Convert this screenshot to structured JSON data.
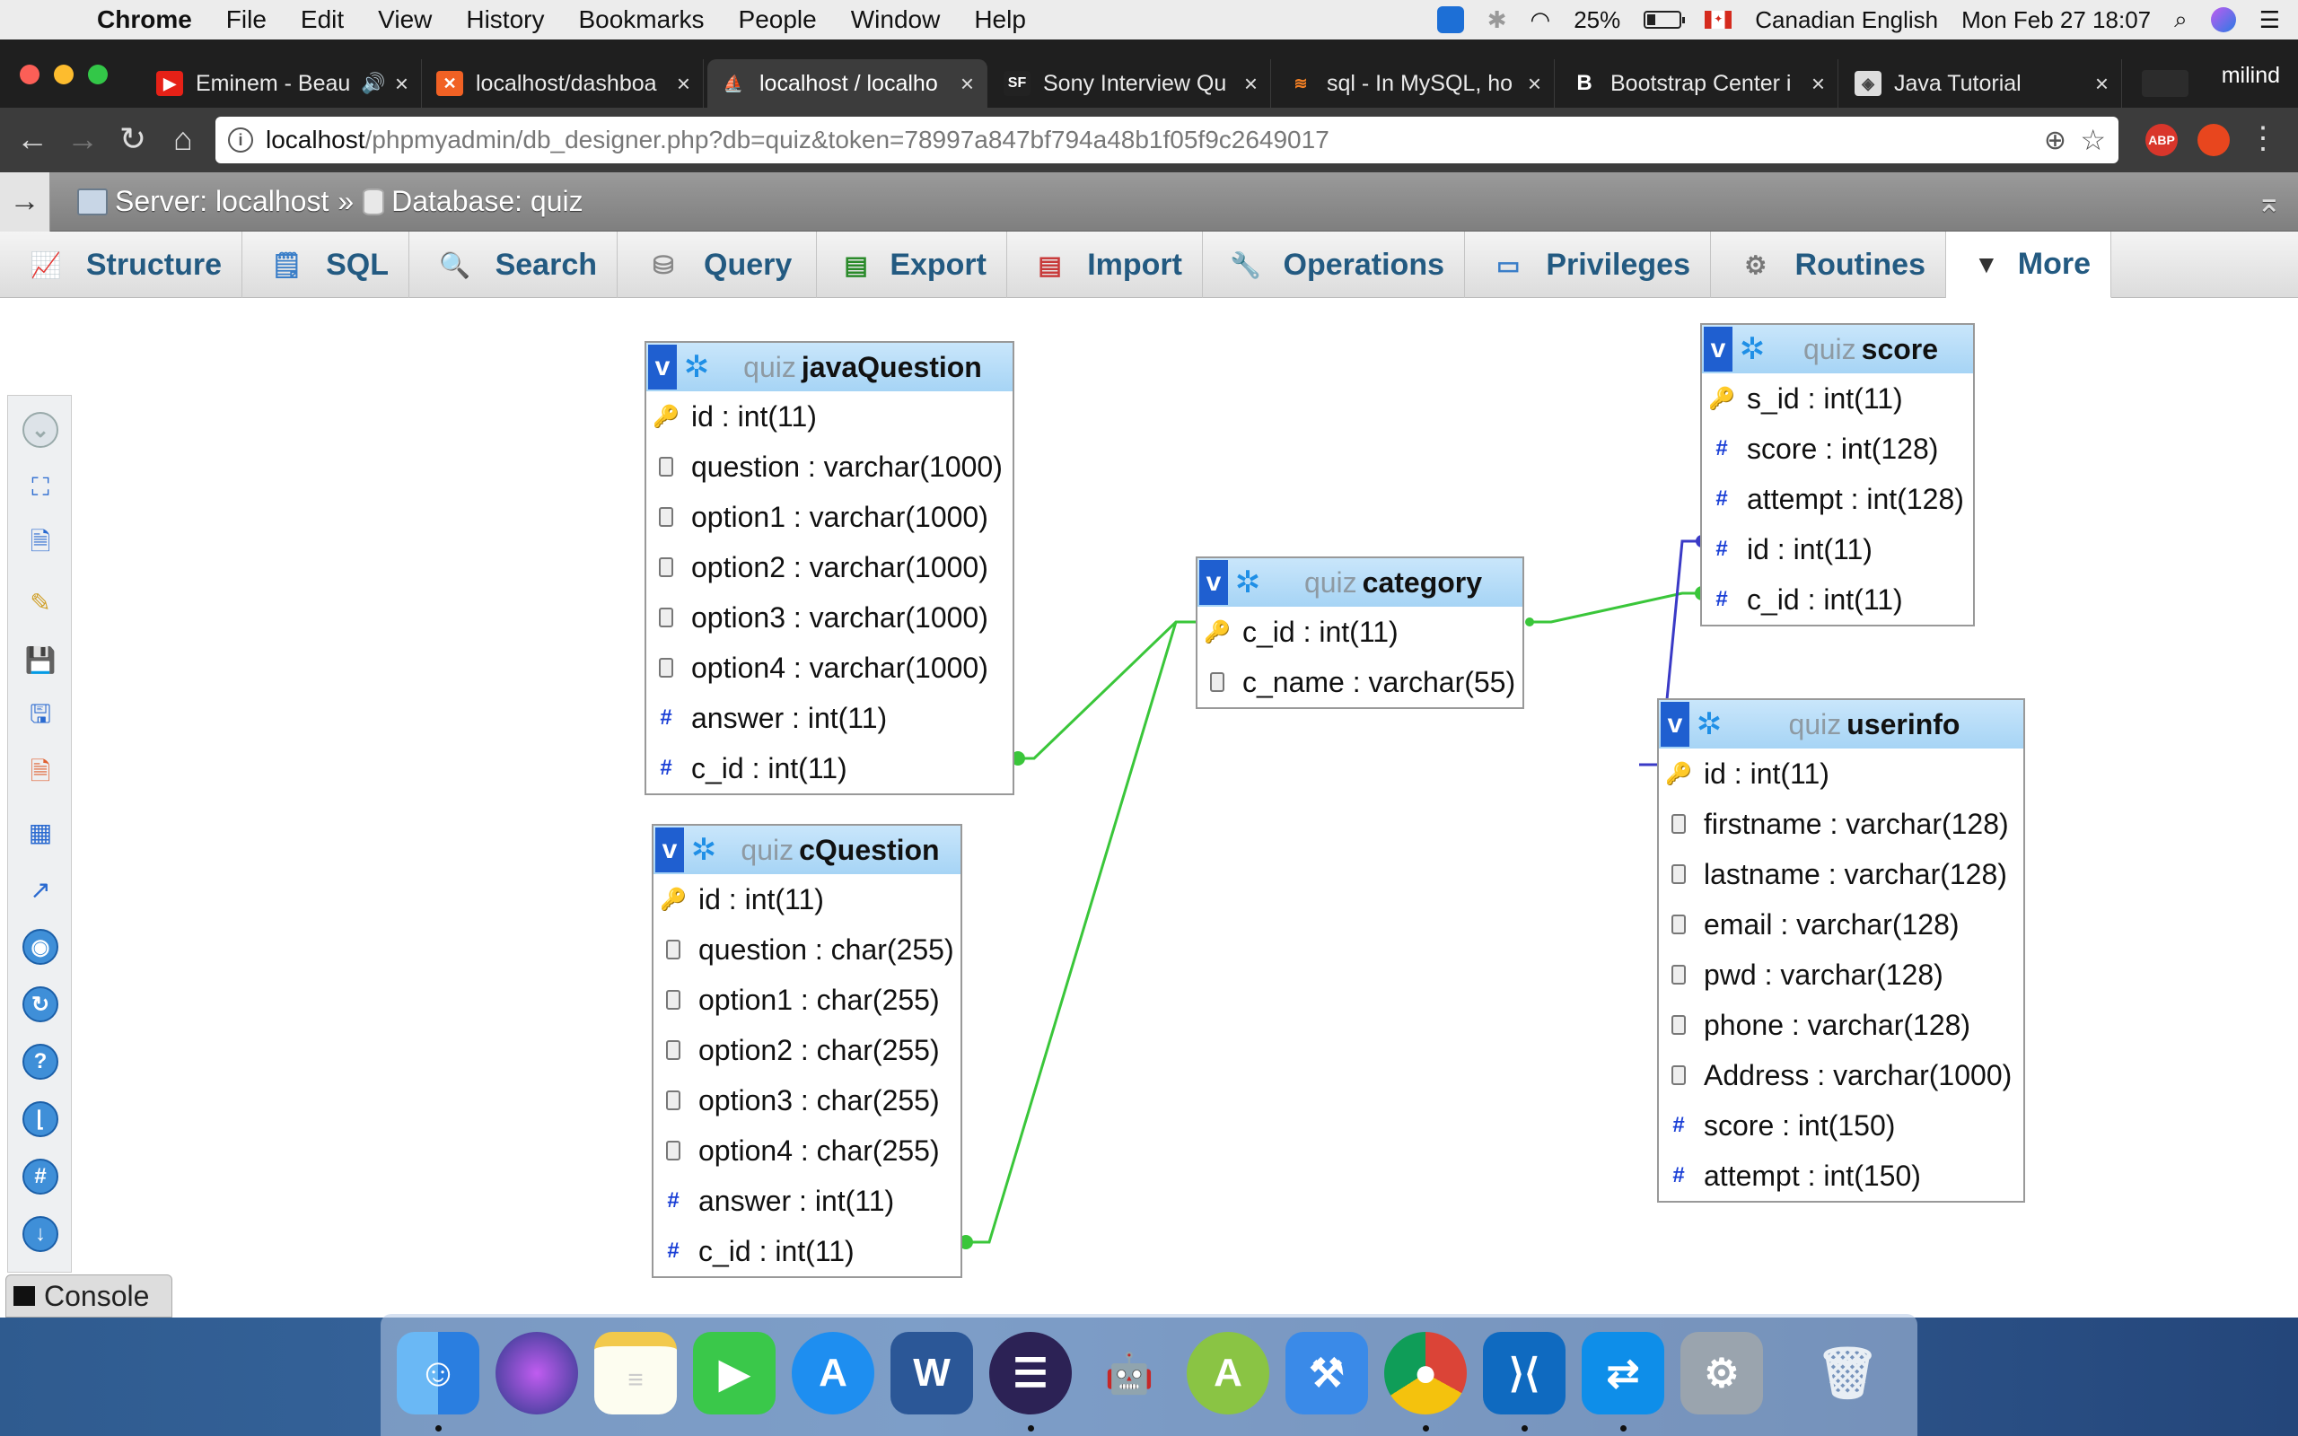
{
  "menubar": {
    "app": "Chrome",
    "items": [
      "File",
      "Edit",
      "View",
      "History",
      "Bookmarks",
      "People",
      "Window",
      "Help"
    ],
    "battery": "25%",
    "input_source": "Canadian English",
    "clock": "Mon Feb 27  18:07"
  },
  "tabs": [
    {
      "title": "Eminem - Beau",
      "icon": "youtube-icon",
      "color": "#e62117"
    },
    {
      "title": "localhost/dashboa",
      "icon": "xampp-icon",
      "color": "#f16124"
    },
    {
      "title": "localhost / localho",
      "icon": "phpmyadmin-icon",
      "color": "#f0a000"
    },
    {
      "title": "Sony Interview Qu",
      "icon": "sf-icon",
      "color": "#222"
    },
    {
      "title": "sql - In MySQL, ho",
      "icon": "stackoverflow-icon",
      "color": "#f48024"
    },
    {
      "title": "Bootstrap Center i",
      "icon": "bootstrap-icon",
      "color": "#222"
    },
    {
      "title": "Java Tutorial",
      "icon": "java-icon",
      "color": "#5a8a5a"
    }
  ],
  "profile": "milind",
  "address": {
    "host": "localhost",
    "path": "/phpmyadmin/db_designer.php?db=quiz&token=78997a847bf794a48b1f05f9c2649017"
  },
  "extensions": [
    "ABP",
    ""
  ],
  "pma": {
    "breadcrumb_server": "Server: localhost",
    "breadcrumb_sep": "»",
    "breadcrumb_db": "Database: quiz",
    "tabs": [
      "Structure",
      "SQL",
      "Search",
      "Query",
      "Export",
      "Import",
      "Operations",
      "Privileges",
      "Routines",
      "More"
    ],
    "console": "Console"
  },
  "tables": {
    "javaQuestion": {
      "db": "quiz",
      "name": "javaQuestion",
      "columns": [
        {
          "text": "id : int(11)",
          "kind": "key"
        },
        {
          "text": "question : varchar(1000)",
          "kind": "text"
        },
        {
          "text": "option1 : varchar(1000)",
          "kind": "text"
        },
        {
          "text": "option2 : varchar(1000)",
          "kind": "text"
        },
        {
          "text": "option3 : varchar(1000)",
          "kind": "text"
        },
        {
          "text": "option4 : varchar(1000)",
          "kind": "text"
        },
        {
          "text": "answer : int(11)",
          "kind": "num"
        },
        {
          "text": "c_id : int(11)",
          "kind": "num"
        }
      ]
    },
    "cQuestion": {
      "db": "quiz",
      "name": "cQuestion",
      "columns": [
        {
          "text": "id : int(11)",
          "kind": "key"
        },
        {
          "text": "question : char(255)",
          "kind": "text"
        },
        {
          "text": "option1 : char(255)",
          "kind": "text"
        },
        {
          "text": "option2 : char(255)",
          "kind": "text"
        },
        {
          "text": "option3 : char(255)",
          "kind": "text"
        },
        {
          "text": "option4 : char(255)",
          "kind": "text"
        },
        {
          "text": "answer : int(11)",
          "kind": "num"
        },
        {
          "text": "c_id : int(11)",
          "kind": "num"
        }
      ]
    },
    "category": {
      "db": "quiz",
      "name": "category",
      "columns": [
        {
          "text": "c_id : int(11)",
          "kind": "key"
        },
        {
          "text": "c_name : varchar(55)",
          "kind": "text"
        }
      ]
    },
    "score": {
      "db": "quiz",
      "name": "score",
      "columns": [
        {
          "text": "s_id : int(11)",
          "kind": "key"
        },
        {
          "text": "score : int(128)",
          "kind": "num"
        },
        {
          "text": "attempt : int(128)",
          "kind": "num"
        },
        {
          "text": "id : int(11)",
          "kind": "num"
        },
        {
          "text": "c_id : int(11)",
          "kind": "num"
        }
      ]
    },
    "userinfo": {
      "db": "quiz",
      "name": "userinfo",
      "columns": [
        {
          "text": "id : int(11)",
          "kind": "key"
        },
        {
          "text": "firstname : varchar(128)",
          "kind": "text"
        },
        {
          "text": "lastname : varchar(128)",
          "kind": "text"
        },
        {
          "text": "email : varchar(128)",
          "kind": "text"
        },
        {
          "text": "pwd : varchar(128)",
          "kind": "text"
        },
        {
          "text": "phone : varchar(128)",
          "kind": "text"
        },
        {
          "text": "Address : varchar(1000)",
          "kind": "text"
        },
        {
          "text": "score : int(150)",
          "kind": "num"
        },
        {
          "text": "attempt : int(150)",
          "kind": "num"
        }
      ]
    }
  },
  "relations_colors": {
    "fk_green": "#3ac63a",
    "fk_blue": "#3a3ac6"
  },
  "dock": [
    "finder-icon",
    "siri-icon",
    "notes-icon",
    "facetime-icon",
    "appstore-icon",
    "word-icon",
    "eclipse-icon",
    "android-icon",
    "android-studio-icon",
    "xcode-icon",
    "chrome-icon",
    "vscode-icon",
    "teamviewer-icon",
    "system-preferences-icon",
    "trash-icon"
  ]
}
